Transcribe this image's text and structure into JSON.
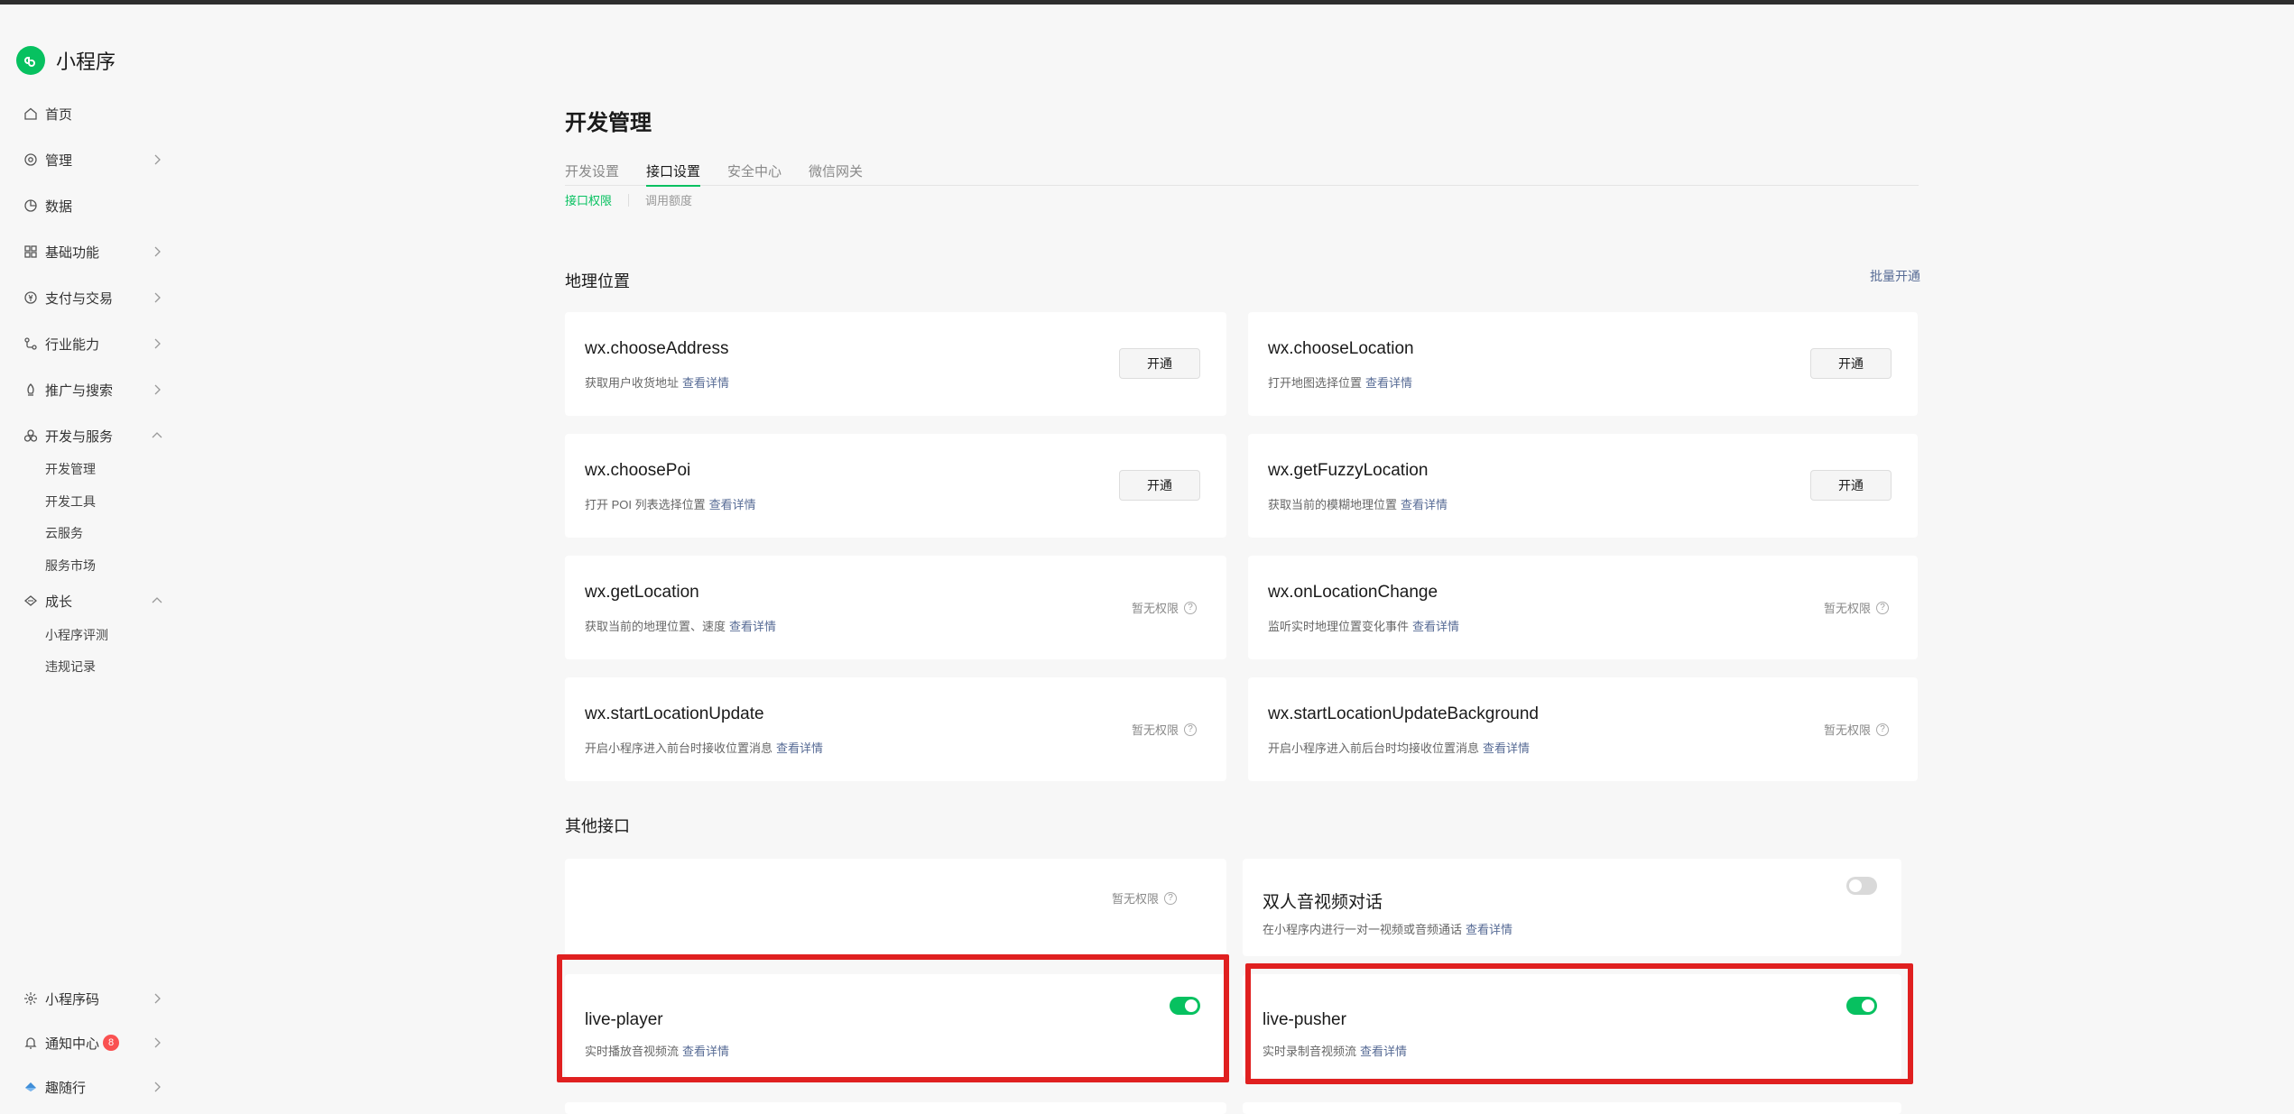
{
  "brand": {
    "title": "小程序",
    "logo_color": "#07c160"
  },
  "sidebar": {
    "items": [
      {
        "label": "首页",
        "icon": "home-icon"
      },
      {
        "label": "管理",
        "icon": "settings-icon"
      },
      {
        "label": "数据",
        "icon": "chart-pie-icon"
      },
      {
        "label": "基础功能",
        "icon": "grid-icon"
      },
      {
        "label": "支付与交易",
        "icon": "payment-icon"
      },
      {
        "label": "行业能力",
        "icon": "industry-icon"
      },
      {
        "label": "推广与搜索",
        "icon": "promote-icon"
      },
      {
        "label": "开发与服务",
        "icon": "dev-service-icon"
      },
      {
        "label": "成长",
        "icon": "growth-icon"
      }
    ],
    "dev_sub": [
      "开发管理",
      "开发工具",
      "云服务",
      "服务市场"
    ],
    "growth_sub": [
      "小程序评测",
      "违规记录"
    ],
    "bottom": [
      {
        "label": "小程序码",
        "icon": "qrcode-icon"
      },
      {
        "label": "通知中心",
        "icon": "bell-icon",
        "badge": "8"
      },
      {
        "label": "趣随行",
        "icon": "account-icon"
      }
    ]
  },
  "page_title": "开发管理",
  "tabs": [
    "开发设置",
    "接口设置",
    "安全中心",
    "微信网关"
  ],
  "subtabs": [
    "接口权限",
    "调用额度"
  ],
  "geo": {
    "title": "地理位置",
    "batch_link": "批量开通",
    "cards": [
      {
        "name": "wx.chooseAddress",
        "desc": "获取用户收货地址",
        "link": "查看详情",
        "action": "开通"
      },
      {
        "name": "wx.chooseLocation",
        "desc": "打开地图选择位置",
        "link": "查看详情",
        "action": "开通"
      },
      {
        "name": "wx.choosePoi",
        "desc": "打开 POI 列表选择位置",
        "link": "查看详情",
        "action": "开通"
      },
      {
        "name": "wx.getFuzzyLocation",
        "desc": "获取当前的模糊地理位置",
        "link": "查看详情",
        "action": "开通"
      },
      {
        "name": "wx.getLocation",
        "desc": "获取当前的地理位置、速度",
        "link": "查看详情",
        "status": "暂无权限"
      },
      {
        "name": "wx.onLocationChange",
        "desc": "监听实时地理位置变化事件",
        "link": "查看详情",
        "status": "暂无权限"
      },
      {
        "name": "wx.startLocationUpdate",
        "desc": "开启小程序进入前台时接收位置消息",
        "link": "查看详情",
        "status": "暂无权限"
      },
      {
        "name": "wx.startLocationUpdateBackground",
        "desc": "开启小程序进入前后台时均接收位置消息",
        "link": "查看详情",
        "status": "暂无权限"
      }
    ]
  },
  "other": {
    "title": "其他接口",
    "cards": [
      {
        "status": "暂无权限"
      },
      {
        "name": "双人音视频对话",
        "desc": "在小程序内进行一对一视频或音频通话",
        "link": "查看详情",
        "toggle": "off"
      },
      {
        "name": "live-player",
        "desc": "实时播放音视频流",
        "link": "查看详情",
        "toggle": "on"
      },
      {
        "name": "live-pusher",
        "desc": "实时录制音视频流",
        "link": "查看详情",
        "toggle": "on"
      }
    ]
  }
}
